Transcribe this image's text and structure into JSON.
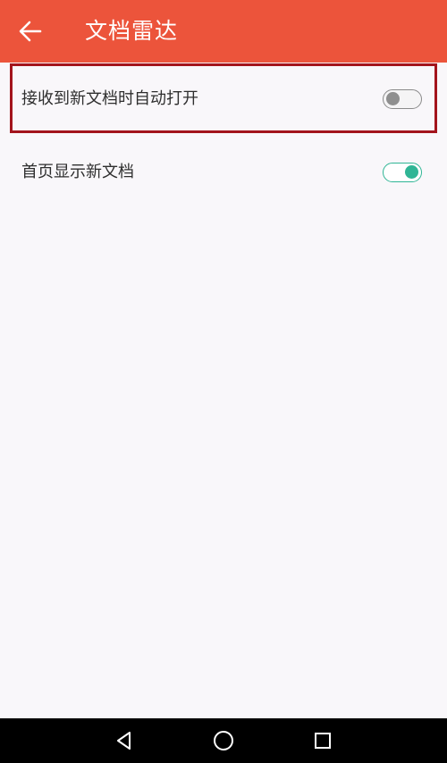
{
  "header": {
    "title": "文档雷达",
    "back_icon": "arrow-left-icon",
    "background": "#ec543b"
  },
  "settings": [
    {
      "label": "接收到新文档时自动打开",
      "enabled": false
    },
    {
      "label": "首页显示新文档",
      "enabled": true
    }
  ],
  "colors": {
    "toggle_on": "#2fb595",
    "toggle_off": "#8f8f8f",
    "highlight": "#a3141c"
  },
  "nav": {
    "back_icon": "triangle-back-icon",
    "home_icon": "circle-home-icon",
    "recent_icon": "square-recent-icon"
  }
}
